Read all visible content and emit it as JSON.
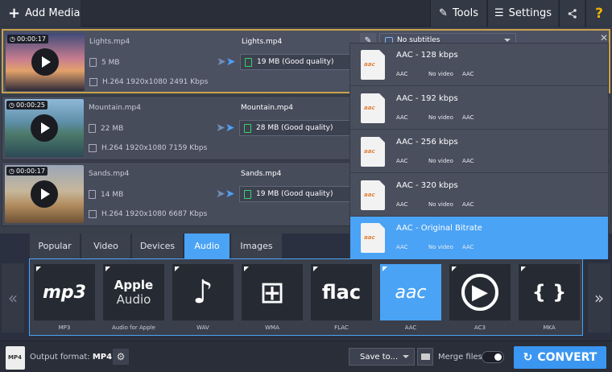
{
  "toolbar": {
    "add_media": "Add Media",
    "tools": "Tools",
    "settings": "Settings",
    "help": "?"
  },
  "files": [
    {
      "duration": "00:00:17",
      "name": "Lights.mp4",
      "size": "5 MB",
      "info": "H.264 1920x1080 2491 Kbps",
      "out_name": "Lights.mp4",
      "out_size": "19 MB (Good quality)",
      "subtitles": "No subtitles"
    },
    {
      "duration": "00:00:25",
      "name": "Mountain.mp4",
      "size": "22 MB",
      "info": "H.264 1920x1080 7159 Kbps",
      "out_name": "Mountain.mp4",
      "out_size": "28 MB (Good quality)"
    },
    {
      "duration": "00:00:17",
      "name": "Sands.mp4",
      "size": "14 MB",
      "info": "H.264 1920x1080 6687 Kbps",
      "out_name": "Sands.mp4",
      "out_size": "19 MB (Good quality)"
    }
  ],
  "presets": [
    {
      "title": "AAC - 128 kbps",
      "a": "AAC",
      "b": "No video",
      "c": "AAC"
    },
    {
      "title": "AAC - 192 kbps",
      "a": "AAC",
      "b": "No video",
      "c": "AAC"
    },
    {
      "title": "AAC - 256 kbps",
      "a": "AAC",
      "b": "No video",
      "c": "AAC"
    },
    {
      "title": "AAC - 320 kbps",
      "a": "AAC",
      "b": "No video",
      "c": "AAC"
    },
    {
      "title": "AAC - Original Bitrate",
      "a": "AAC",
      "b": "No video",
      "c": "AAC"
    }
  ],
  "preset_icon_label": "aac",
  "tabs": [
    "Popular",
    "Video",
    "Devices",
    "Audio",
    "Images"
  ],
  "formats": [
    {
      "label": "MP3",
      "icon_text": "mp3"
    },
    {
      "label": "Audio for Apple",
      "icon_text": "Apple",
      "icon_text2": "Audio"
    },
    {
      "label": "WAV",
      "icon_text": "♪"
    },
    {
      "label": "WMA",
      "icon_text": "⊞"
    },
    {
      "label": "FLAC",
      "icon_text": "flac"
    },
    {
      "label": "AAC",
      "icon_text": "aac"
    },
    {
      "label": "AC3",
      "icon_text": "▶"
    },
    {
      "label": "MKA",
      "icon_text": "{ }"
    }
  ],
  "bottom": {
    "output_label": "Output format:",
    "output_value": "MP4",
    "mp4_icon": "MP4",
    "save_to": "Save to...",
    "merge": "Merge files:",
    "convert": "CONVERT"
  },
  "colors": {
    "accent": "#4aa3f5",
    "selected_border": "#c9a24a",
    "convert": "#3a96f0"
  }
}
